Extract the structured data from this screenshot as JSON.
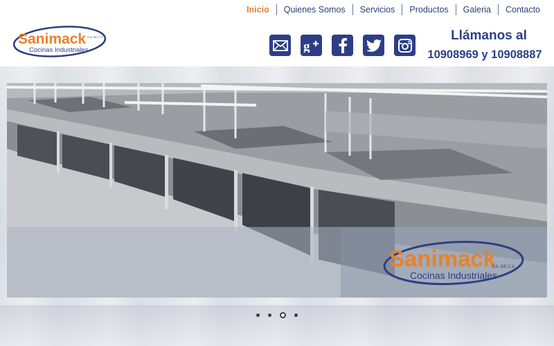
{
  "nav": {
    "items": [
      {
        "label": "Inicio",
        "active": true
      },
      {
        "label": "Quienes Somos",
        "active": false
      },
      {
        "label": "Servicios",
        "active": false
      },
      {
        "label": "Productos",
        "active": false
      },
      {
        "label": "Galeria",
        "active": false
      },
      {
        "label": "Contacto",
        "active": false
      }
    ]
  },
  "brand": {
    "name": "Sanimack",
    "suffix": "S.A. DE C.V.",
    "tagline": "Cocinas Industriales",
    "colors": {
      "orange": "#e8822a",
      "navy": "#2c3f86"
    }
  },
  "social": {
    "icons": [
      "mail-icon",
      "google-plus-icon",
      "facebook-icon",
      "twitter-icon",
      "instagram-icon"
    ]
  },
  "contact": {
    "line1": "Llámanos al",
    "line2": "10908969 y 10908887"
  },
  "slider": {
    "slide_count": 4,
    "active_index": 2,
    "caption_brand": "Sanimack",
    "caption_suffix": "S.A. DE C.V.",
    "caption_tagline": "Cocinas Industriales"
  }
}
